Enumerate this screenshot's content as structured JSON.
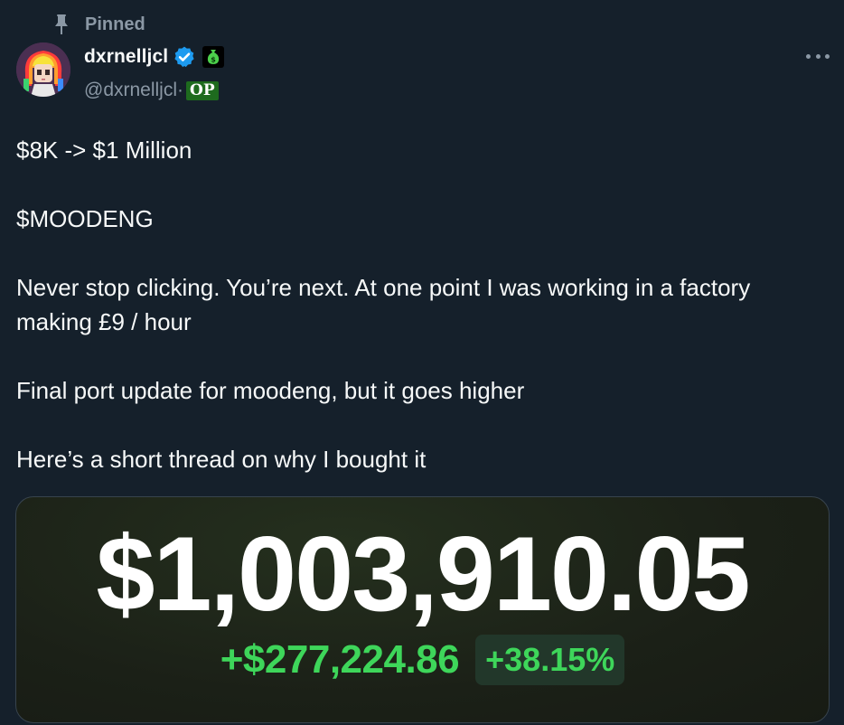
{
  "pinned": {
    "label": "Pinned",
    "icon": "pin-icon"
  },
  "author": {
    "display_name": "dxrnelljcl",
    "handle": "@dxrnelljcl",
    "separator": "·",
    "op_badge": "OP",
    "verified_icon": "verified-badge-icon",
    "verified_color": "#1d9bf0",
    "emoji_badge": "money-bag-icon",
    "avatar": "avatar"
  },
  "more_button": {
    "icon": "more-options-icon"
  },
  "tweet": {
    "paragraphs": [
      "$8K -> $1 Million",
      "$MOODENG",
      "Never stop clicking. You’re next. At one point I was working in a factory making £9 / hour",
      "Final port update for moodeng, but it goes higher",
      "Here’s a short thread on why I bought it"
    ]
  },
  "media": {
    "portfolio_value": "$1,003,910.05",
    "change_amount": "+$277,224.86",
    "change_percent": "+38.15%",
    "positive_color": "#3ed65a"
  },
  "colors": {
    "background": "#15202b",
    "text_primary": "#f7f9f9",
    "text_secondary": "#8b98a5"
  }
}
